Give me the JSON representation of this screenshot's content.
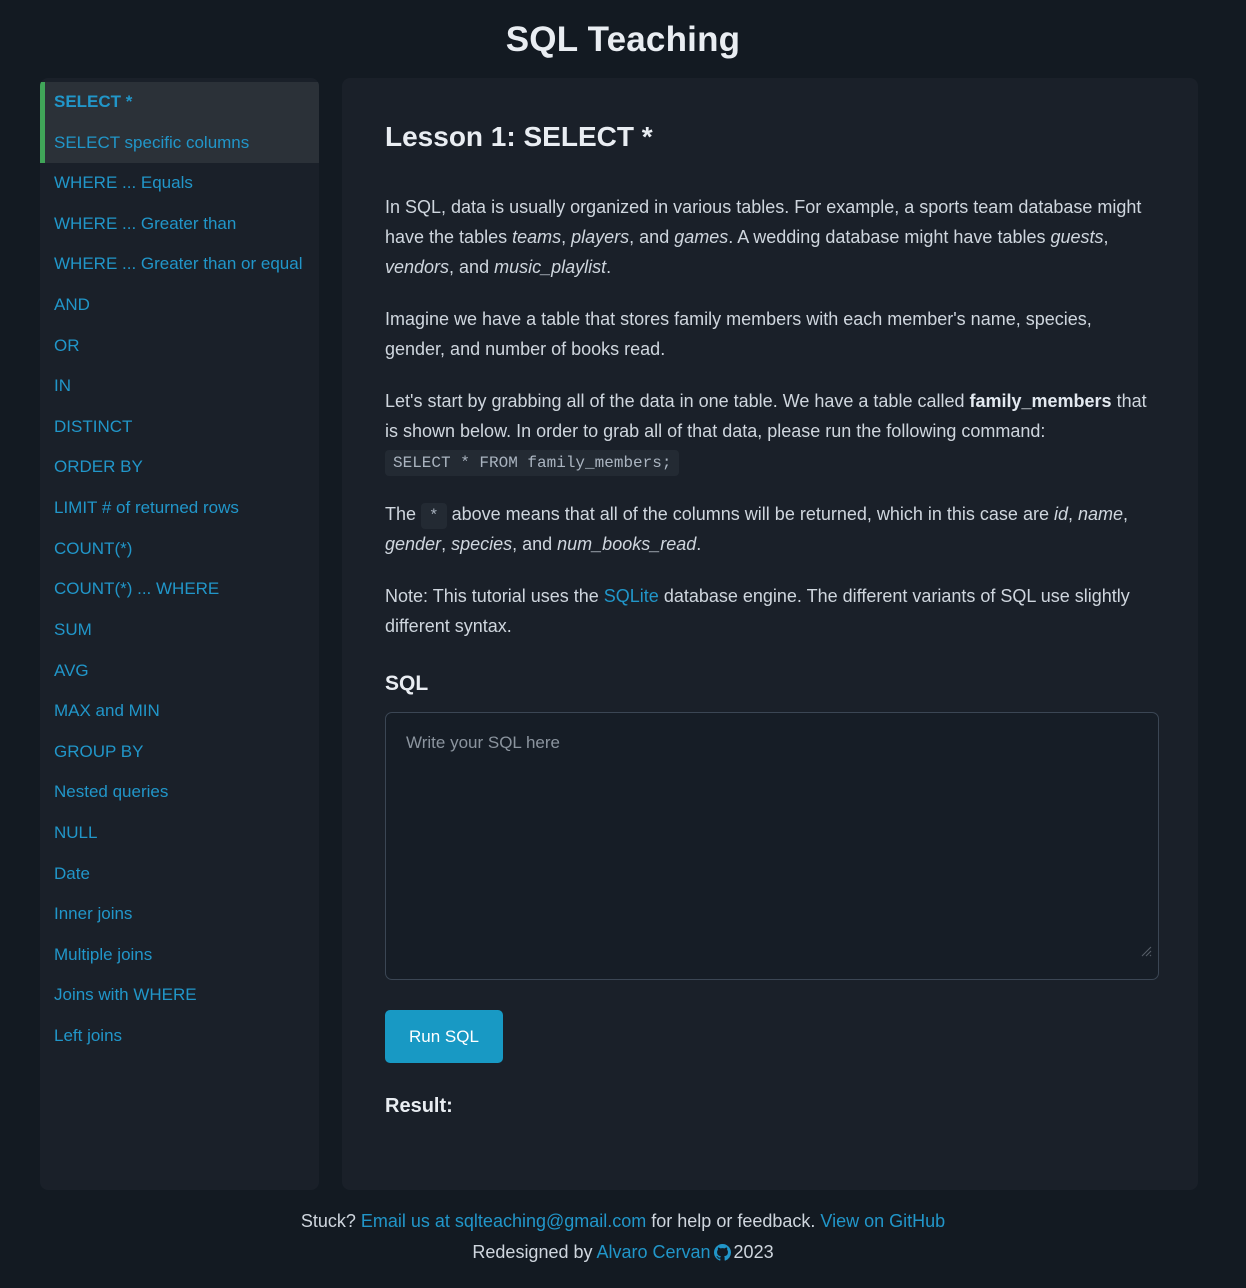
{
  "header": {
    "title": "SQL Teaching"
  },
  "sidebar": {
    "items": [
      {
        "label": "SELECT *",
        "state": "active"
      },
      {
        "label": "SELECT specific columns",
        "state": "done"
      },
      {
        "label": "WHERE ... Equals",
        "state": ""
      },
      {
        "label": "WHERE ... Greater than",
        "state": ""
      },
      {
        "label": "WHERE ... Greater than or equal",
        "state": ""
      },
      {
        "label": "AND",
        "state": ""
      },
      {
        "label": "OR",
        "state": ""
      },
      {
        "label": "IN",
        "state": ""
      },
      {
        "label": "DISTINCT",
        "state": ""
      },
      {
        "label": "ORDER BY",
        "state": ""
      },
      {
        "label": "LIMIT # of returned rows",
        "state": ""
      },
      {
        "label": "COUNT(*)",
        "state": ""
      },
      {
        "label": "COUNT(*) ... WHERE",
        "state": ""
      },
      {
        "label": "SUM",
        "state": ""
      },
      {
        "label": "AVG",
        "state": ""
      },
      {
        "label": "MAX and MIN",
        "state": ""
      },
      {
        "label": "GROUP BY",
        "state": ""
      },
      {
        "label": "Nested queries",
        "state": ""
      },
      {
        "label": "NULL",
        "state": ""
      },
      {
        "label": "Date",
        "state": ""
      },
      {
        "label": "Inner joins",
        "state": ""
      },
      {
        "label": "Multiple joins",
        "state": ""
      },
      {
        "label": "Joins with WHERE",
        "state": ""
      },
      {
        "label": "Left joins",
        "state": ""
      }
    ]
  },
  "lesson": {
    "title": "Lesson 1: SELECT *",
    "p1_a": "In SQL, data is usually organized in various tables. For example, a sports team database might have the tables ",
    "p1_t1": "teams",
    "p1_b": ", ",
    "p1_t2": "players",
    "p1_c": ", and ",
    "p1_t3": "games",
    "p1_d": ". A wedding database might have tables ",
    "p1_t4": "guests",
    "p1_e": ", ",
    "p1_t5": "vendors",
    "p1_f": ", and ",
    "p1_t6": "music_playlist",
    "p1_g": ".",
    "p2": "Imagine we have a table that stores family members with each member's name, species, gender, and number of books read.",
    "p3_a": "Let's start by grabbing all of the data in one table. We have a table called ",
    "p3_table": "family_members",
    "p3_b": " that is shown below. In order to grab all of that data, please run the following command: ",
    "p3_code": "SELECT * FROM family_members;",
    "p4_a": "The ",
    "p4_code": "*",
    "p4_b": " above means that all of the columns will be returned, which in this case are ",
    "p4_c1": "id",
    "p4_sep1": ", ",
    "p4_c2": "name",
    "p4_sep2": ", ",
    "p4_c3": "gender",
    "p4_sep3": ", ",
    "p4_c4": "species",
    "p4_sep4": ", and ",
    "p4_c5": "num_books_read",
    "p4_end": ".",
    "p5_a": "Note: This tutorial uses the ",
    "p5_link": "SQLite",
    "p5_b": " database engine. The different variants of SQL use slightly different syntax.",
    "sql_section_title": "SQL",
    "sql_placeholder": "Write your SQL here",
    "sql_value": "",
    "run_button": "Run SQL",
    "result_label": "Result:"
  },
  "footer": {
    "line1_a": "Stuck? ",
    "line1_email": "Email us at sqlteaching@gmail.com",
    "line1_b": " for help or feedback. ",
    "line1_github": "View on GitHub",
    "line2_a": "Redesigned by ",
    "line2_author": "Alvaro Cervan",
    "line2_year": "2023"
  },
  "colors": {
    "page_bg": "#131a22",
    "panel_bg": "#1a2029",
    "accent_link": "#2196c9",
    "accent_button": "#1899c4",
    "progress_green": "#40a558",
    "nav_active_bg": "#2b3138"
  }
}
